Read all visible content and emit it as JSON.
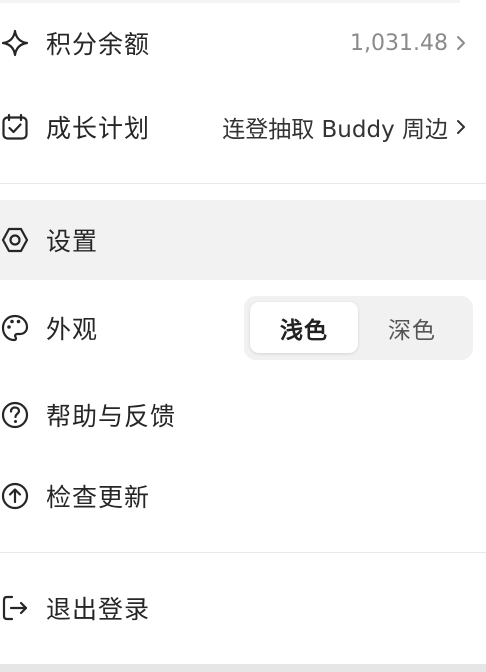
{
  "menu": {
    "points": {
      "label": "积分余额",
      "value": "1,031.48",
      "icon": "sparkle-icon"
    },
    "growth": {
      "label": "成长计划",
      "value": "连登抽取 Buddy 周边",
      "icon": "calendar-check-icon"
    },
    "settings": {
      "label": "设置",
      "icon": "gear-icon"
    },
    "appearance": {
      "label": "外观",
      "icon": "palette-icon",
      "options": [
        "浅色",
        "深色"
      ],
      "selected": "浅色"
    },
    "help": {
      "label": "帮助与反馈",
      "icon": "question-circle-icon"
    },
    "update": {
      "label": "检查更新",
      "icon": "arrow-up-circle-icon"
    },
    "logout": {
      "label": "退出登录",
      "icon": "logout-icon"
    }
  },
  "colors": {
    "hover_row": "#f2f2f2",
    "divider": "#e9e9e9",
    "segment_bg": "#f1f1f1",
    "text": "#262626",
    "muted": "#8a8a8a"
  }
}
